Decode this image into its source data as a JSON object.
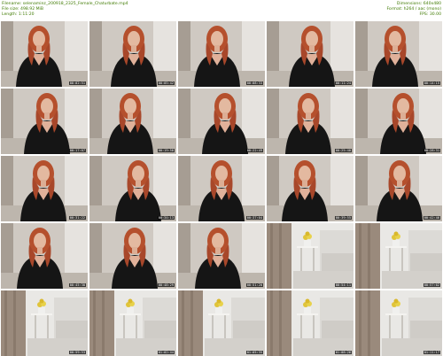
{
  "header": {
    "filename": "Filename: selenaminz_200918_2325_Female_Chaturbate.mp4",
    "filesize": "File size: 498.92 MiB",
    "length": "Length: 1:11:20",
    "dimensions": "Dimensions: 640x480",
    "format": "Format: h264 / aac (mono)",
    "fps": "FPS: 30.00"
  },
  "accent_color": "#3f7a00",
  "thumbnails": [
    {
      "timestamp": "00:02:51",
      "scene": "woman"
    },
    {
      "timestamp": "00:05:42",
      "scene": "woman"
    },
    {
      "timestamp": "00:08:33",
      "scene": "woman"
    },
    {
      "timestamp": "00:11:24",
      "scene": "woman"
    },
    {
      "timestamp": "00:14:15",
      "scene": "woman"
    },
    {
      "timestamp": "00:17:07",
      "scene": "woman"
    },
    {
      "timestamp": "00:19:58",
      "scene": "woman"
    },
    {
      "timestamp": "00:22:49",
      "scene": "woman"
    },
    {
      "timestamp": "00:25:40",
      "scene": "woman"
    },
    {
      "timestamp": "00:28:31",
      "scene": "woman"
    },
    {
      "timestamp": "00:31:22",
      "scene": "woman"
    },
    {
      "timestamp": "00:34:13",
      "scene": "woman"
    },
    {
      "timestamp": "00:37:04",
      "scene": "woman"
    },
    {
      "timestamp": "00:39:55",
      "scene": "woman"
    },
    {
      "timestamp": "00:42:46",
      "scene": "woman"
    },
    {
      "timestamp": "00:45:38",
      "scene": "woman"
    },
    {
      "timestamp": "00:48:29",
      "scene": "woman"
    },
    {
      "timestamp": "00:51:20",
      "scene": "woman"
    },
    {
      "timestamp": "00:54:11",
      "scene": "room"
    },
    {
      "timestamp": "00:57:02",
      "scene": "room"
    },
    {
      "timestamp": "00:59:53",
      "scene": "room"
    },
    {
      "timestamp": "01:02:44",
      "scene": "room"
    },
    {
      "timestamp": "01:05:35",
      "scene": "room"
    },
    {
      "timestamp": "01:08:26",
      "scene": "room"
    },
    {
      "timestamp": "01:11:17",
      "scene": "room"
    }
  ]
}
